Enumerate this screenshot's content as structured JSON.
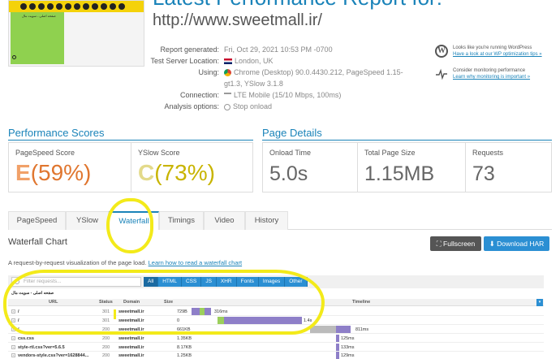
{
  "report": {
    "title": "Latest Performance Report for:",
    "url": "http://www.sweetmall.ir/"
  },
  "thumbnail": {
    "rtl_text": "صفحه اصلی - سویت مال"
  },
  "meta": [
    {
      "label": "Report generated:",
      "value": "Fri, Oct 29, 2021 10:53 PM -0700",
      "icon": "none"
    },
    {
      "label": "Test Server Location:",
      "value": "London, UK",
      "icon": "uk-flag-icon"
    },
    {
      "label": "Using:",
      "value": "Chrome (Desktop) 90.0.4430.212, PageSpeed 1.15-gt1.3, YSlow 3.1.8",
      "icon": "chrome-icon"
    },
    {
      "label": "Connection:",
      "value": "LTE Mobile (15/10 Mbps, 100ms)",
      "icon": "signal-icon"
    },
    {
      "label": "Analysis options:",
      "value": "Stop onload",
      "icon": "stop-icon"
    }
  ],
  "side_notes": {
    "wordpress": {
      "text": "Looks like you're running WordPress",
      "link": "Have a look at our WP optimization tips »"
    },
    "monitor": {
      "text": "Consider monitoring performance",
      "link": "Learn why monitoring is important »"
    }
  },
  "performance": {
    "section_title": "Performance Scores",
    "pagespeed": {
      "label": "PageSpeed Score",
      "letter": "E",
      "percent": "(59%)",
      "value": 59
    },
    "yslow": {
      "label": "YSlow Score",
      "letter": "C",
      "percent": "(73%)",
      "value": 73
    }
  },
  "details": {
    "section_title": "Page Details",
    "onload": {
      "label": "Onload Time",
      "value": "5.0s"
    },
    "size": {
      "label": "Total Page Size",
      "value": "1.15MB"
    },
    "requests": {
      "label": "Requests",
      "value": "73"
    }
  },
  "tabs": [
    "PageSpeed",
    "YSlow",
    "Waterfall",
    "Timings",
    "Video",
    "History"
  ],
  "active_tab": "Waterfall",
  "waterfall": {
    "title": "Waterfall Chart",
    "fullscreen_label": "Fullscreen",
    "download_label": "Download HAR",
    "description": "A request-by-request visualization of the page load.",
    "learn_link": "Learn how to read a waterfall chart",
    "filter_placeholder": "Filter requests...",
    "filters": [
      "All",
      "HTML",
      "CSS",
      "JS",
      "XHR",
      "Fonts",
      "Images",
      "Other"
    ],
    "active_filter": "All",
    "rtl_line": "صفحه اصلی - سویت مال",
    "columns": {
      "url": "URL",
      "status": "Status",
      "domain": "Domain",
      "size": "Size",
      "timeline": "Timeline"
    },
    "rows": [
      {
        "url": "/",
        "status": "301",
        "domain": "sweetmall.ir",
        "size": "729B",
        "time": "316ms"
      },
      {
        "url": "/",
        "status": "301",
        "domain": "sweetmall.ir",
        "size": "0",
        "time": "1.4s"
      },
      {
        "url": "/",
        "status": "200",
        "domain": "sweetmall.ir",
        "size": "661KB",
        "time": "811ms"
      },
      {
        "url": "css.css",
        "status": "200",
        "domain": "sweetmall.ir",
        "size": "1.35KB",
        "time": "125ms"
      },
      {
        "url": "style-rtl.css?ver=5.6.5",
        "status": "200",
        "domain": "sweetmall.ir",
        "size": "8.17KB",
        "time": "133ms"
      },
      {
        "url": "vendors-style.css?ver=1628844...",
        "status": "200",
        "domain": "sweetmall.ir",
        "size": "1.25KB",
        "time": "129ms"
      }
    ]
  },
  "colors": {
    "accent": "#1a83b9",
    "annotation": "#f3ea1a",
    "grade_e": "#e0762f",
    "grade_c": "#c8b400"
  }
}
